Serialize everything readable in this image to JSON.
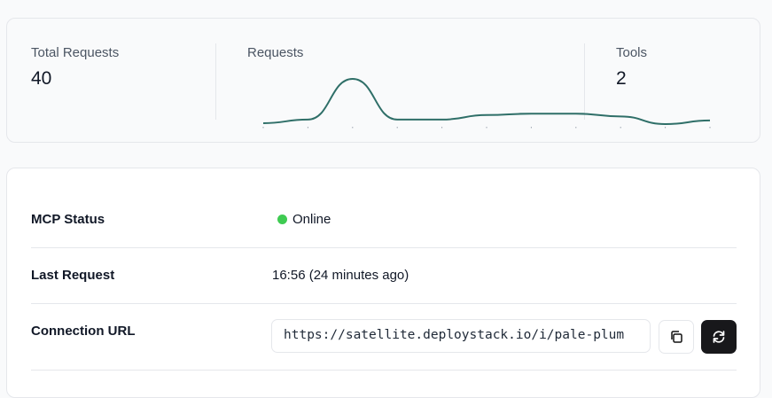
{
  "stats": {
    "total_requests_label": "Total Requests",
    "total_requests_value": "40",
    "requests_label": "Requests",
    "tools_label": "Tools",
    "tools_value": "2"
  },
  "chart_data": {
    "type": "line",
    "title": "Requests",
    "values": [
      0.2,
      1,
      10,
      1,
      1,
      2,
      2.3,
      2.3,
      1.7,
      0,
      0.8
    ],
    "ylim": [
      0,
      10
    ],
    "color": "#2f6f68"
  },
  "details": {
    "status_label": "MCP Status",
    "status_value": "Online",
    "status_color": "#3fcb52",
    "last_request_label": "Last Request",
    "last_request_value": "16:56 (24 minutes ago)",
    "connection_url_label": "Connection URL",
    "connection_url_value": "https://satellite.deploystack.io/i/pale-plum"
  }
}
